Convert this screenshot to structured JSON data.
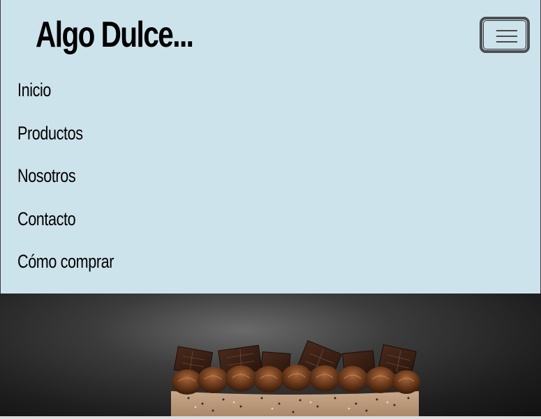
{
  "header": {
    "brand": "Algo Dulce...",
    "toggler_icon": "hamburger-menu-icon"
  },
  "nav": {
    "items": [
      {
        "label": "Inicio"
      },
      {
        "label": "Productos"
      },
      {
        "label": "Nosotros"
      },
      {
        "label": "Contacto"
      },
      {
        "label": "Cómo comprar"
      }
    ]
  },
  "hero": {
    "image": "chocolate cake"
  },
  "colors": {
    "navbar_bg": "#cde3ec",
    "text": "#000000",
    "toggler_border": "#4d4f52"
  }
}
